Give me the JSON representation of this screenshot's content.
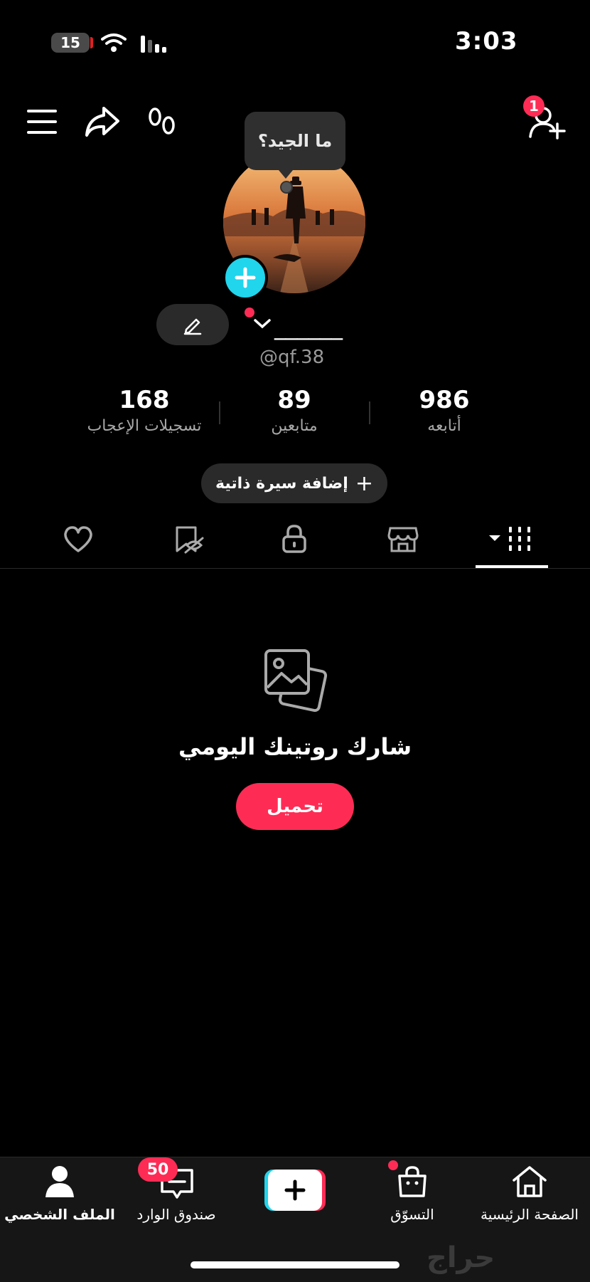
{
  "status": {
    "time": "3:03",
    "battery": "15"
  },
  "header": {
    "friends_badge": "1",
    "tooltip": "ما الجيد؟"
  },
  "profile": {
    "username": "______",
    "handle": "@qf.38"
  },
  "stats": [
    {
      "value": "986",
      "label": "أتابعه"
    },
    {
      "value": "89",
      "label": "متابعين"
    },
    {
      "value": "168",
      "label": "تسجيلات الإعجاب"
    }
  ],
  "bio_button": {
    "label": "إضافة سيرة ذاتية",
    "plus": "+"
  },
  "empty_state": {
    "title": "شارك روتينك اليومي",
    "upload_label": "تحميل"
  },
  "bottom_nav": {
    "home": "الصفحة الرئيسية",
    "shop": "التسوّق",
    "inbox": "صندوق الوارد",
    "inbox_badge": "50",
    "profile": "الملف الشخصي"
  },
  "watermark": "حراج",
  "colors": {
    "accent_red": "#fe2c55",
    "accent_cyan": "#20d5ec",
    "background": "#000000"
  }
}
